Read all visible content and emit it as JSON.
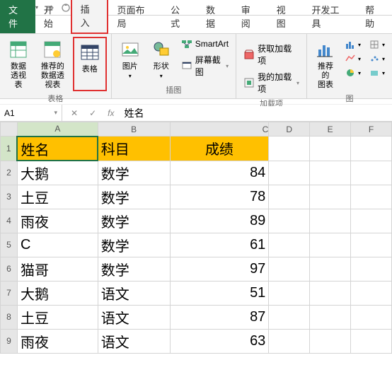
{
  "qat": {
    "save": "save-icon",
    "undo": "undo-icon",
    "redo": "redo-icon",
    "more1": "refresh-icon",
    "more2": "attach-icon"
  },
  "tabs": {
    "file": "文件",
    "home": "开始",
    "insert": "插入",
    "layout": "页面布局",
    "formulas": "公式",
    "data": "数据",
    "review": "审阅",
    "view": "视图",
    "dev": "开发工具",
    "help": "帮助"
  },
  "ribbon": {
    "tables": {
      "pivot": "数据\n透视表",
      "recommended_pivot": "推荐的\n数据透视表",
      "table": "表格",
      "group_label": "表格"
    },
    "illustrations": {
      "pictures": "图片",
      "shapes": "形状",
      "smartart": "SmartArt",
      "screenshot": "屏幕截图",
      "group_label": "插图"
    },
    "addins": {
      "get": "获取加载项",
      "my": "我的加载项",
      "group_label": "加载项"
    },
    "charts": {
      "recommended": "推荐的\n图表",
      "group_label": "图"
    }
  },
  "formula_bar": {
    "name_box": "A1",
    "fx": "fx",
    "value": "姓名"
  },
  "columns": [
    "A",
    "B",
    "C",
    "D",
    "E",
    "F"
  ],
  "headers": [
    "姓名",
    "科目",
    "成绩"
  ],
  "rows": [
    {
      "n": 1
    },
    {
      "n": 2,
      "a": "大鹅",
      "b": "数学",
      "c": "84"
    },
    {
      "n": 3,
      "a": "土豆",
      "b": "数学",
      "c": "78"
    },
    {
      "n": 4,
      "a": "雨夜",
      "b": "数学",
      "c": "89"
    },
    {
      "n": 5,
      "a": "C",
      "b": "数学",
      "c": "61"
    },
    {
      "n": 6,
      "a": "猫哥",
      "b": "数学",
      "c": "97"
    },
    {
      "n": 7,
      "a": "大鹅",
      "b": "语文",
      "c": "51"
    },
    {
      "n": 8,
      "a": "土豆",
      "b": "语文",
      "c": "87"
    },
    {
      "n": 9,
      "a": "雨夜",
      "b": "语文",
      "c": "63"
    }
  ]
}
